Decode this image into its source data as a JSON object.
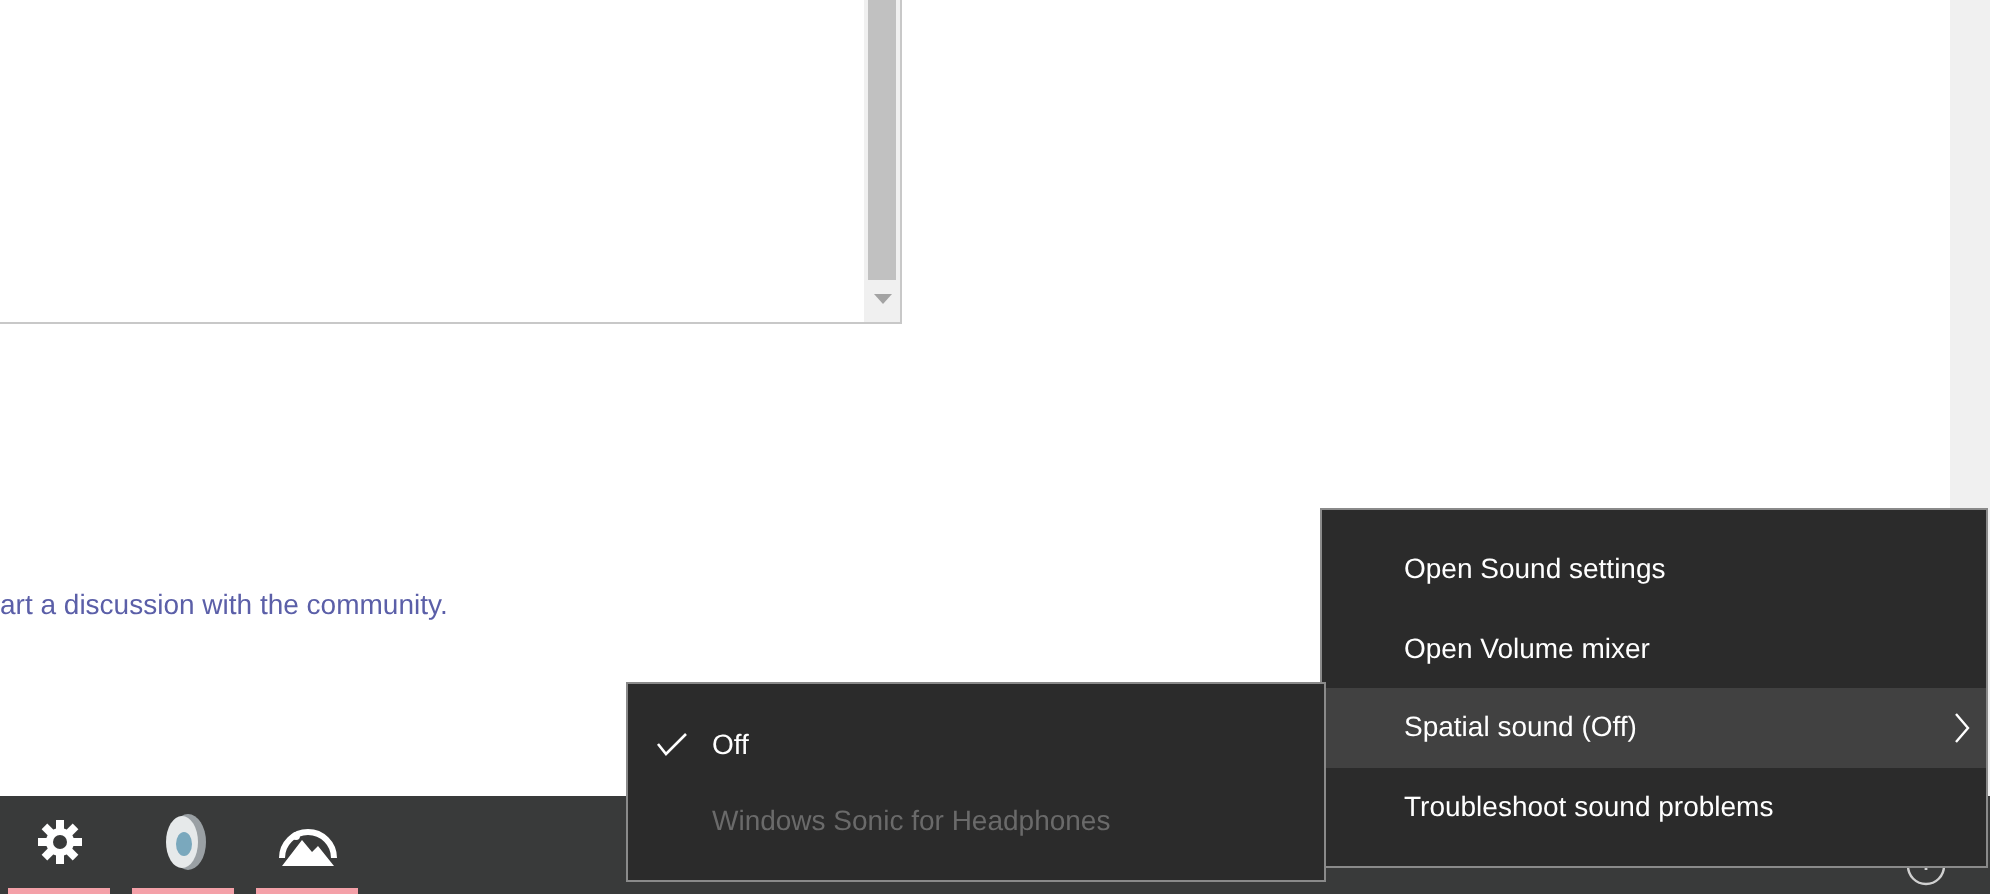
{
  "page": {
    "partial_text": "art a discussion with the community."
  },
  "taskbar": {
    "icons": [
      {
        "kind": "gear",
        "running": true
      },
      {
        "kind": "speaker",
        "running": true
      },
      {
        "kind": "photos",
        "running": true
      }
    ]
  },
  "context_menu": {
    "items": [
      {
        "label": "Open Sound settings",
        "selected": false,
        "kind": "plain"
      },
      {
        "label": "Open Volume mixer",
        "selected": false,
        "kind": "plain"
      },
      {
        "label": "Spatial sound (Off)",
        "selected": true,
        "kind": "submenu"
      },
      {
        "label": "Troubleshoot sound problems",
        "selected": false,
        "kind": "plain"
      }
    ]
  },
  "submenu": {
    "items": [
      {
        "label": "Off",
        "checked": true,
        "disabled": false
      },
      {
        "label": "Windows Sonic for Headphones",
        "checked": false,
        "disabled": true
      }
    ]
  }
}
